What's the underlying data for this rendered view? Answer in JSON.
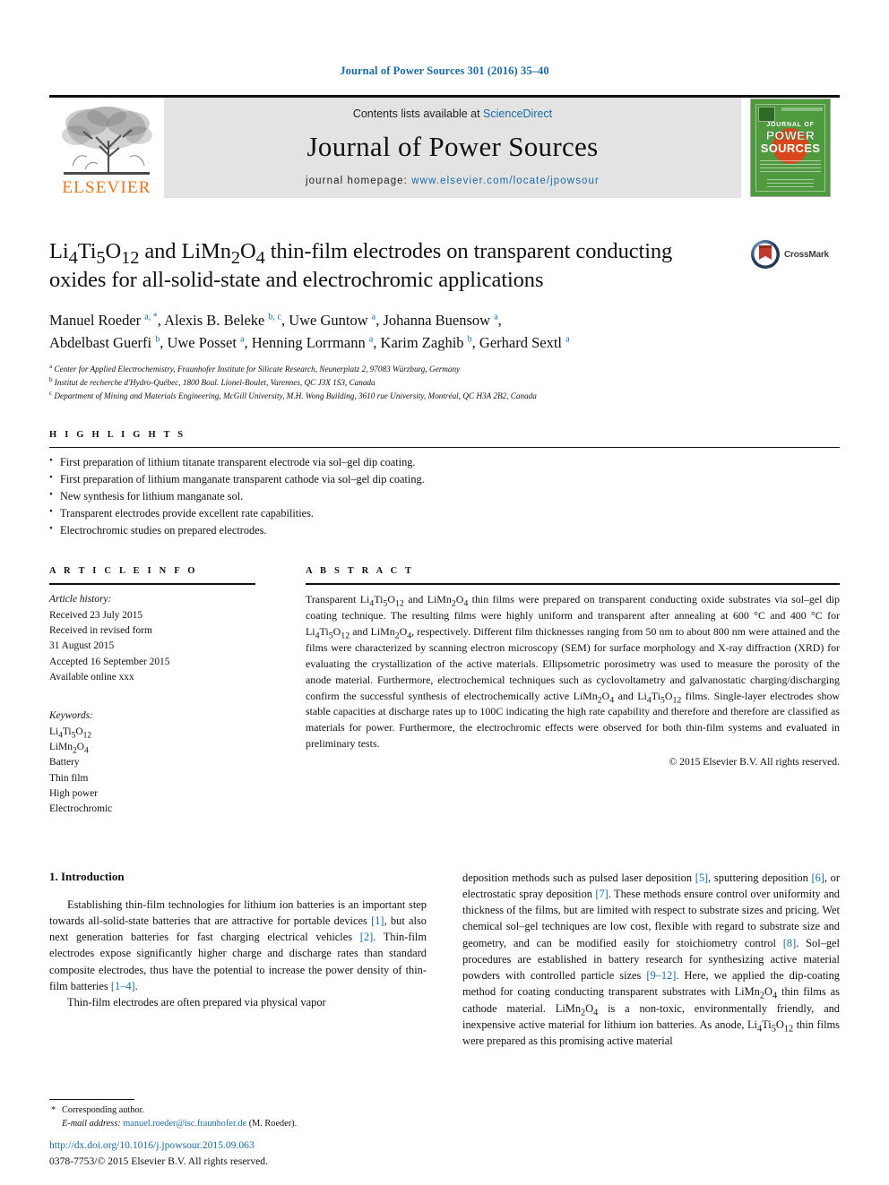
{
  "running_head": "Journal of Power Sources 301 (2016) 35–40",
  "masthead": {
    "contents_prefix": "Contents lists available at ",
    "sciencedirect": "ScienceDirect",
    "journal_name": "Journal of Power Sources",
    "homepage_prefix": "journal homepage: ",
    "homepage_url": "www.elsevier.com/locate/jpowsour",
    "publisher_word": "ELSEVIER",
    "cover": {
      "journal_of": "JOURNAL OF",
      "power": "POWER",
      "sources": "SOURCES"
    },
    "link_color": "#1a6aa8",
    "panel_color": "#e3e3e3",
    "elsevier_orange": "#e87722",
    "cover_green": "#4f9a3f"
  },
  "title": {
    "line1": "Li₄Ti₅O₁₂ and LiMn₂O₄ thin-film electrodes on transparent conducting",
    "line2": "oxides for all-solid-state and electrochromic applications",
    "crossmark_label": "CrossMark"
  },
  "authors": {
    "line1": "Manuel Roeder a, *, Alexis B. Beleke b, c, Uwe Guntow a, Johanna Buensow a,",
    "line2": "Abdelbast Guerfi b, Uwe Posset a, Henning Lorrmann a, Karim Zaghib b, Gerhard Sextl a",
    "affiliations": [
      "a Center for Applied Electrochemistry, Fraunhofer Institute for Silicate Research, Neunerplatz 2, 97083 Würzburg, Germany",
      "b Institut de recherche d'Hydro-Québec, 1800 Boul. Lionel-Boulet, Varennes, QC J3X 1S3, Canada",
      "c Department of Mining and Materials Engineering, McGill University, M.H. Wong Building, 3610 rue University, Montréal, QC H3A 2B2, Canada"
    ]
  },
  "highlights": {
    "heading": "H I G H L I G H T S",
    "items": [
      "First preparation of lithium titanate transparent electrode via sol–gel dip coating.",
      "First preparation of lithium manganate transparent cathode via sol–gel dip coating.",
      "New synthesis for lithium manganate sol.",
      "Transparent electrodes provide excellent rate capabilities.",
      "Electrochromic studies on prepared electrodes."
    ]
  },
  "article_info": {
    "heading": "A R T I C L E  I N F O",
    "history_label": "Article history:",
    "history": [
      "Received 23 July 2015",
      "Received in revised form",
      "31 August 2015",
      "Accepted 16 September 2015",
      "Available online xxx"
    ],
    "keywords_label": "Keywords:",
    "keywords": [
      "Li4Ti5O12",
      "LiMn2O4",
      "Battery",
      "Thin film",
      "High power",
      "Electrochromic"
    ]
  },
  "abstract": {
    "heading": "A B S T R A C T",
    "text": "Transparent Li4Ti5O12 and LiMn2O4 thin films were prepared on transparent conducting oxide substrates via sol–gel dip coating technique. The resulting films were highly uniform and transparent after annealing at 600 °C and 400 °C for Li4Ti5O12 and LiMn2O4, respectively. Different film thicknesses ranging from 50 nm to about 800 nm were attained and the films were characterized by scanning electron microscopy (SEM) for surface morphology and X-ray diffraction (XRD) for evaluating the crystallization of the active materials. Ellipsometric porosimetry was used to measure the porosity of the anode material. Furthermore, electrochemical techniques such as cyclovoltametry and galvanostatic charging/discharging confirm the successful synthesis of electrochemically active LiMn2O4 and Li4Ti5O12 films. Single-layer electrodes show stable capacities at discharge rates up to 100C indicating the high rate capability and therefore and therefore are classified as materials for power. Furthermore, the electrochromic effects were observed for both thin-film systems and evaluated in preliminary tests.",
    "copyright": "© 2015 Elsevier B.V. All rights reserved."
  },
  "body": {
    "section_number_title": "1.  Introduction",
    "left_para1": "Establishing thin-film technologies for lithium ion batteries is an important step towards all-solid-state batteries that are attractive for portable devices [1], but also next generation batteries for fast charging electrical vehicles [2]. Thin-film electrodes expose significantly higher charge and discharge rates than standard composite electrodes, thus have the potential to increase the power density of thin-film batteries [1–4].",
    "left_para2": "Thin-film electrodes are often prepared via physical vapor",
    "right_para1": "deposition methods such as pulsed laser deposition [5], sputtering deposition [6], or electrostatic spray deposition [7]. These methods ensure control over uniformity and thickness of the films, but are limited with respect to substrate sizes and pricing. Wet chemical sol–gel techniques are low cost, flexible with regard to substrate size and geometry, and can be modified easily for stoichiometry control [8]. Sol–gel procedures are established in battery research for synthesizing active material powders with controlled particle sizes [9–12]. Here, we applied the dip-coating method for coating conducting transparent substrates with LiMn2O4 thin films as cathode material. LiMn2O4 is a non-toxic, environmentally friendly, and inexpensive active material for lithium ion batteries. As anode, Li4Ti5O12 thin films were prepared as this promising active material"
  },
  "footnotes": {
    "corresponding": "Corresponding author.",
    "email_label": "E-mail address:",
    "email": "manuel.roeder@isc.fraunhofer.de",
    "email_suffix": "(M. Roeder).",
    "doi": "http://dx.doi.org/10.1016/j.jpowsour.2015.09.063",
    "issn_line": "0378-7753/© 2015 Elsevier B.V. All rights reserved."
  }
}
